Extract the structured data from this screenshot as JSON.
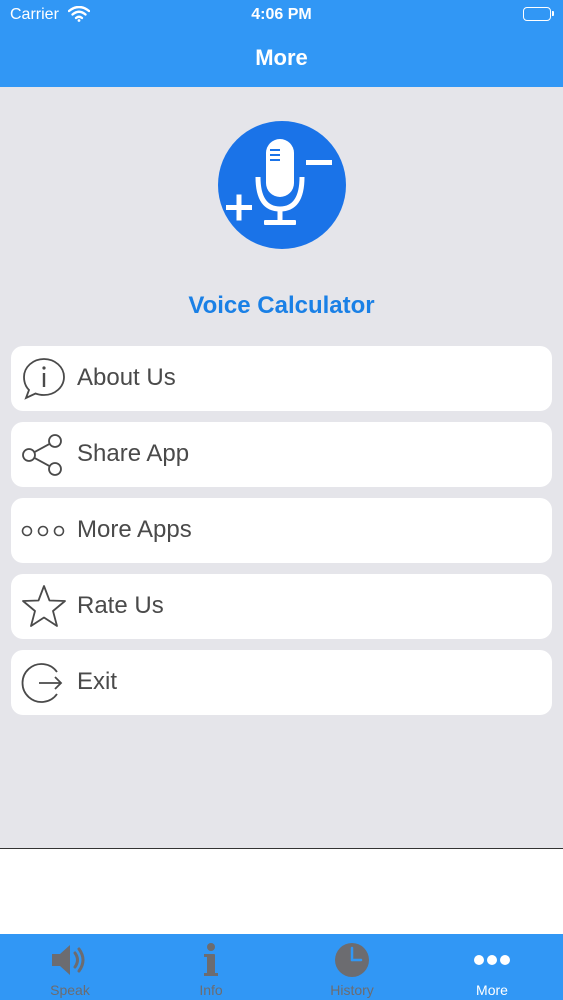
{
  "status_bar": {
    "carrier": "Carrier",
    "time": "4:06 PM"
  },
  "nav": {
    "title": "More"
  },
  "app": {
    "name": "Voice Calculator"
  },
  "menu": [
    {
      "label": "About Us",
      "icon": "info-bubble-icon"
    },
    {
      "label": "Share App",
      "icon": "share-icon"
    },
    {
      "label": "More Apps",
      "icon": "three-circles-icon"
    },
    {
      "label": "Rate Us",
      "icon": "star-icon"
    },
    {
      "label": "Exit",
      "icon": "exit-icon"
    }
  ],
  "tabs": [
    {
      "label": "Speak",
      "icon": "speaker-icon",
      "active": false
    },
    {
      "label": "Info",
      "icon": "info-icon",
      "active": false
    },
    {
      "label": "History",
      "icon": "clock-icon",
      "active": false
    },
    {
      "label": "More",
      "icon": "more-dots-icon",
      "active": true
    }
  ],
  "colors": {
    "brand": "#3197f5",
    "logo": "#1a73e8",
    "app_name": "#1a80e6",
    "inactive_tab": "#6c6c70"
  }
}
